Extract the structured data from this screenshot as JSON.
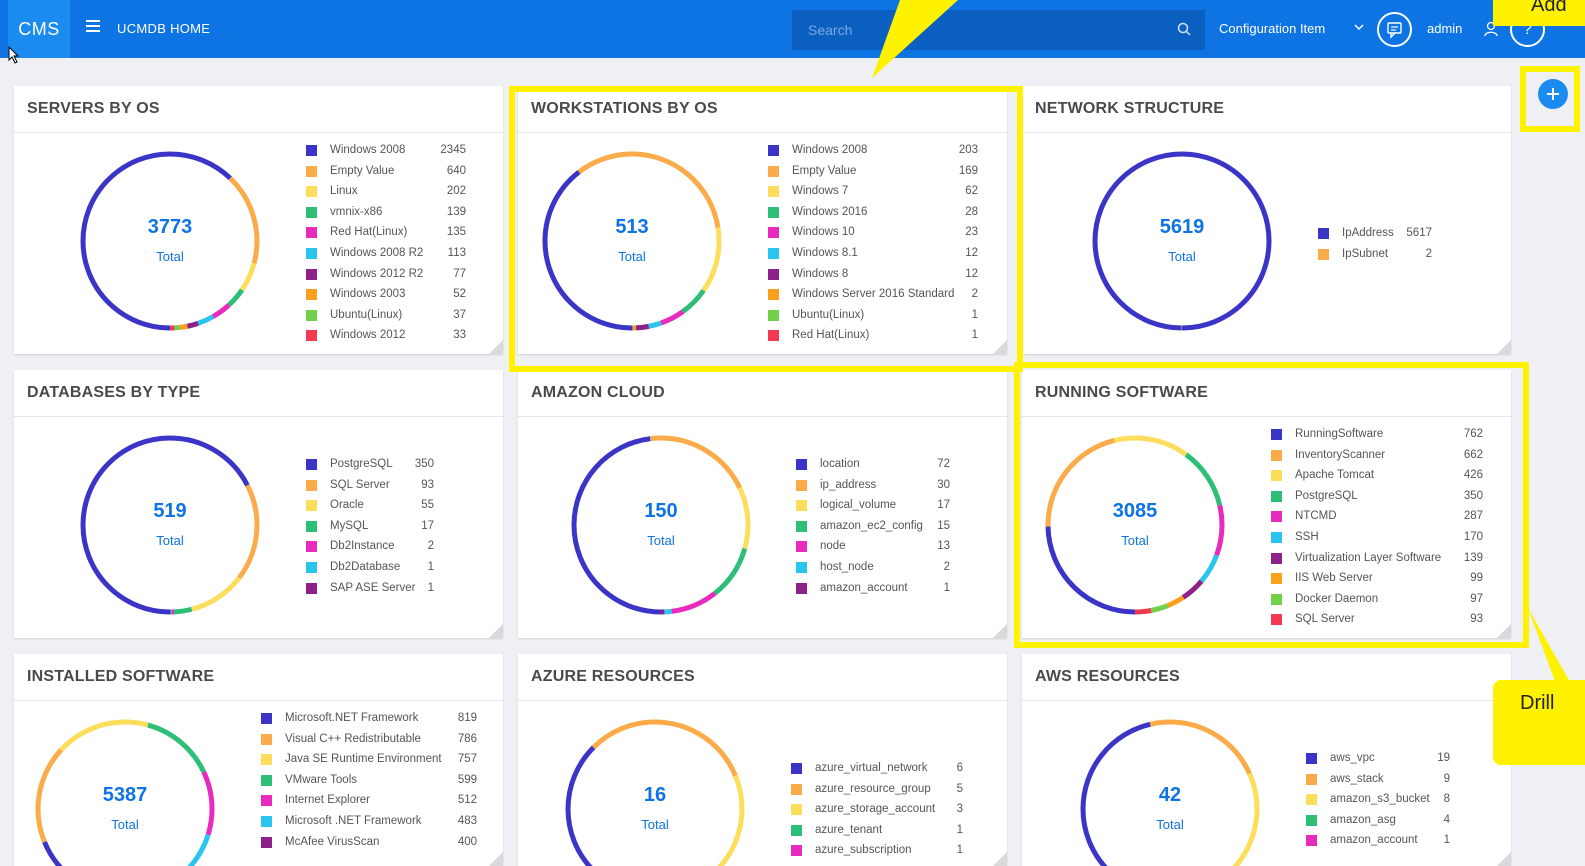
{
  "topbar": {
    "logo": "CMS",
    "home_label": "UCMDB HOME",
    "search_placeholder": "Search",
    "ci_dropdown": "Configuration Item",
    "user": "admin",
    "help": "?"
  },
  "colors": {
    "brand": "#0e73e3",
    "highlight": "#fff200",
    "palette": [
      "#3a35c7",
      "#fbab49",
      "#fddd5c",
      "#2dbf77",
      "#e82bbc",
      "#29c5ef",
      "#8e2189",
      "#fba01c",
      "#72d04a",
      "#f23b53"
    ]
  },
  "overlays": {
    "top_callout": "Add",
    "drill_callout": "Drill"
  },
  "cards": [
    {
      "title": "SERVERS BY OS",
      "total": "3773",
      "total_label": "Total",
      "items": [
        {
          "label": "Windows 2008",
          "value": "2345",
          "color": "#3a35c7"
        },
        {
          "label": "Empty Value",
          "value": "640",
          "color": "#fbab49"
        },
        {
          "label": "Linux",
          "value": "202",
          "color": "#fddd5c"
        },
        {
          "label": "vmnix-x86",
          "value": "139",
          "color": "#2dbf77"
        },
        {
          "label": "Red Hat(Linux)",
          "value": "135",
          "color": "#e82bbc"
        },
        {
          "label": "Windows 2008 R2",
          "value": "113",
          "color": "#29c5ef"
        },
        {
          "label": "Windows 2012 R2",
          "value": "77",
          "color": "#8e2189"
        },
        {
          "label": "Windows 2003",
          "value": "52",
          "color": "#fba01c"
        },
        {
          "label": "Ubuntu(Linux)",
          "value": "37",
          "color": "#72d04a"
        },
        {
          "label": "Windows 2012",
          "value": "33",
          "color": "#f23b53"
        }
      ]
    },
    {
      "title": "WORKSTATIONS BY OS",
      "total": "513",
      "total_label": "Total",
      "items": [
        {
          "label": "Windows 2008",
          "value": "203",
          "color": "#3a35c7"
        },
        {
          "label": "Empty Value",
          "value": "169",
          "color": "#fbab49"
        },
        {
          "label": "Windows 7",
          "value": "62",
          "color": "#fddd5c"
        },
        {
          "label": "Windows 2016",
          "value": "28",
          "color": "#2dbf77"
        },
        {
          "label": "Windows 10",
          "value": "23",
          "color": "#e82bbc"
        },
        {
          "label": "Windows 8.1",
          "value": "12",
          "color": "#29c5ef"
        },
        {
          "label": "Windows 8",
          "value": "12",
          "color": "#8e2189"
        },
        {
          "label": "Windows Server 2016 Standard",
          "value": "2",
          "color": "#fba01c"
        },
        {
          "label": "Ubuntu(Linux)",
          "value": "1",
          "color": "#72d04a"
        },
        {
          "label": "Red Hat(Linux)",
          "value": "1",
          "color": "#f23b53"
        }
      ]
    },
    {
      "title": "NETWORK STRUCTURE",
      "total": "5619",
      "total_label": "Total",
      "items": [
        {
          "label": "IpAddress",
          "value": "5617",
          "color": "#3a35c7"
        },
        {
          "label": "IpSubnet",
          "value": "2",
          "color": "#fbab49"
        }
      ]
    },
    {
      "title": "DATABASES BY TYPE",
      "total": "519",
      "total_label": "Total",
      "items": [
        {
          "label": "PostgreSQL",
          "value": "350",
          "color": "#3a35c7"
        },
        {
          "label": "SQL Server",
          "value": "93",
          "color": "#fbab49"
        },
        {
          "label": "Oracle",
          "value": "55",
          "color": "#fddd5c"
        },
        {
          "label": "MySQL",
          "value": "17",
          "color": "#2dbf77"
        },
        {
          "label": "Db2Instance",
          "value": "2",
          "color": "#e82bbc"
        },
        {
          "label": "Db2Database",
          "value": "1",
          "color": "#29c5ef"
        },
        {
          "label": "SAP ASE Server",
          "value": "1",
          "color": "#8e2189"
        }
      ]
    },
    {
      "title": "AMAZON CLOUD",
      "total": "150",
      "total_label": "Total",
      "items": [
        {
          "label": "location",
          "value": "72",
          "color": "#3a35c7"
        },
        {
          "label": "ip_address",
          "value": "30",
          "color": "#fbab49"
        },
        {
          "label": "logical_volume",
          "value": "17",
          "color": "#fddd5c"
        },
        {
          "label": "amazon_ec2_config",
          "value": "15",
          "color": "#2dbf77"
        },
        {
          "label": "node",
          "value": "13",
          "color": "#e82bbc"
        },
        {
          "label": "host_node",
          "value": "2",
          "color": "#29c5ef"
        },
        {
          "label": "amazon_account",
          "value": "1",
          "color": "#8e2189"
        }
      ]
    },
    {
      "title": "RUNNING SOFTWARE",
      "total": "3085",
      "total_label": "Total",
      "items": [
        {
          "label": "RunningSoftware",
          "value": "762",
          "color": "#3a35c7"
        },
        {
          "label": "InventoryScanner",
          "value": "662",
          "color": "#fbab49"
        },
        {
          "label": "Apache Tomcat",
          "value": "426",
          "color": "#fddd5c"
        },
        {
          "label": "PostgreSQL",
          "value": "350",
          "color": "#2dbf77"
        },
        {
          "label": "NTCMD",
          "value": "287",
          "color": "#e82bbc"
        },
        {
          "label": "SSH",
          "value": "170",
          "color": "#29c5ef"
        },
        {
          "label": "Virtualization Layer Software",
          "value": "139",
          "color": "#8e2189"
        },
        {
          "label": "IIS Web Server",
          "value": "99",
          "color": "#fba01c"
        },
        {
          "label": "Docker Daemon",
          "value": "97",
          "color": "#72d04a"
        },
        {
          "label": "SQL Server",
          "value": "93",
          "color": "#f23b53"
        }
      ]
    },
    {
      "title": "INSTALLED SOFTWARE",
      "total": "5387",
      "total_label": "Total",
      "items": [
        {
          "label": "Microsoft.NET Framework",
          "value": "819",
          "color": "#3a35c7"
        },
        {
          "label": "Visual C++ Redistributable",
          "value": "786",
          "color": "#fbab49"
        },
        {
          "label": "Java SE Runtime Environment",
          "value": "757",
          "color": "#fddd5c"
        },
        {
          "label": "VMware Tools",
          "value": "599",
          "color": "#2dbf77"
        },
        {
          "label": "Internet Explorer",
          "value": "512",
          "color": "#e82bbc"
        },
        {
          "label": "Microsoft .NET Framework",
          "value": "483",
          "color": "#29c5ef"
        },
        {
          "label": "McAfee VirusScan",
          "value": "400",
          "color": "#8e2189"
        }
      ]
    },
    {
      "title": "AZURE RESOURCES",
      "total": "16",
      "total_label": "Total",
      "items": [
        {
          "label": "azure_virtual_network",
          "value": "6",
          "color": "#3a35c7"
        },
        {
          "label": "azure_resource_group",
          "value": "5",
          "color": "#fbab49"
        },
        {
          "label": "azure_storage_account",
          "value": "3",
          "color": "#fddd5c"
        },
        {
          "label": "azure_tenant",
          "value": "1",
          "color": "#2dbf77"
        },
        {
          "label": "azure_subscription",
          "value": "1",
          "color": "#e82bbc"
        }
      ]
    },
    {
      "title": "AWS RESOURCES",
      "total": "42",
      "total_label": "Total",
      "items": [
        {
          "label": "aws_vpc",
          "value": "19",
          "color": "#3a35c7"
        },
        {
          "label": "aws_stack",
          "value": "9",
          "color": "#fbab49"
        },
        {
          "label": "amazon_s3_bucket",
          "value": "8",
          "color": "#fddd5c"
        },
        {
          "label": "amazon_asg",
          "value": "4",
          "color": "#2dbf77"
        },
        {
          "label": "amazon_account",
          "value": "1",
          "color": "#e82bbc"
        }
      ]
    }
  ]
}
